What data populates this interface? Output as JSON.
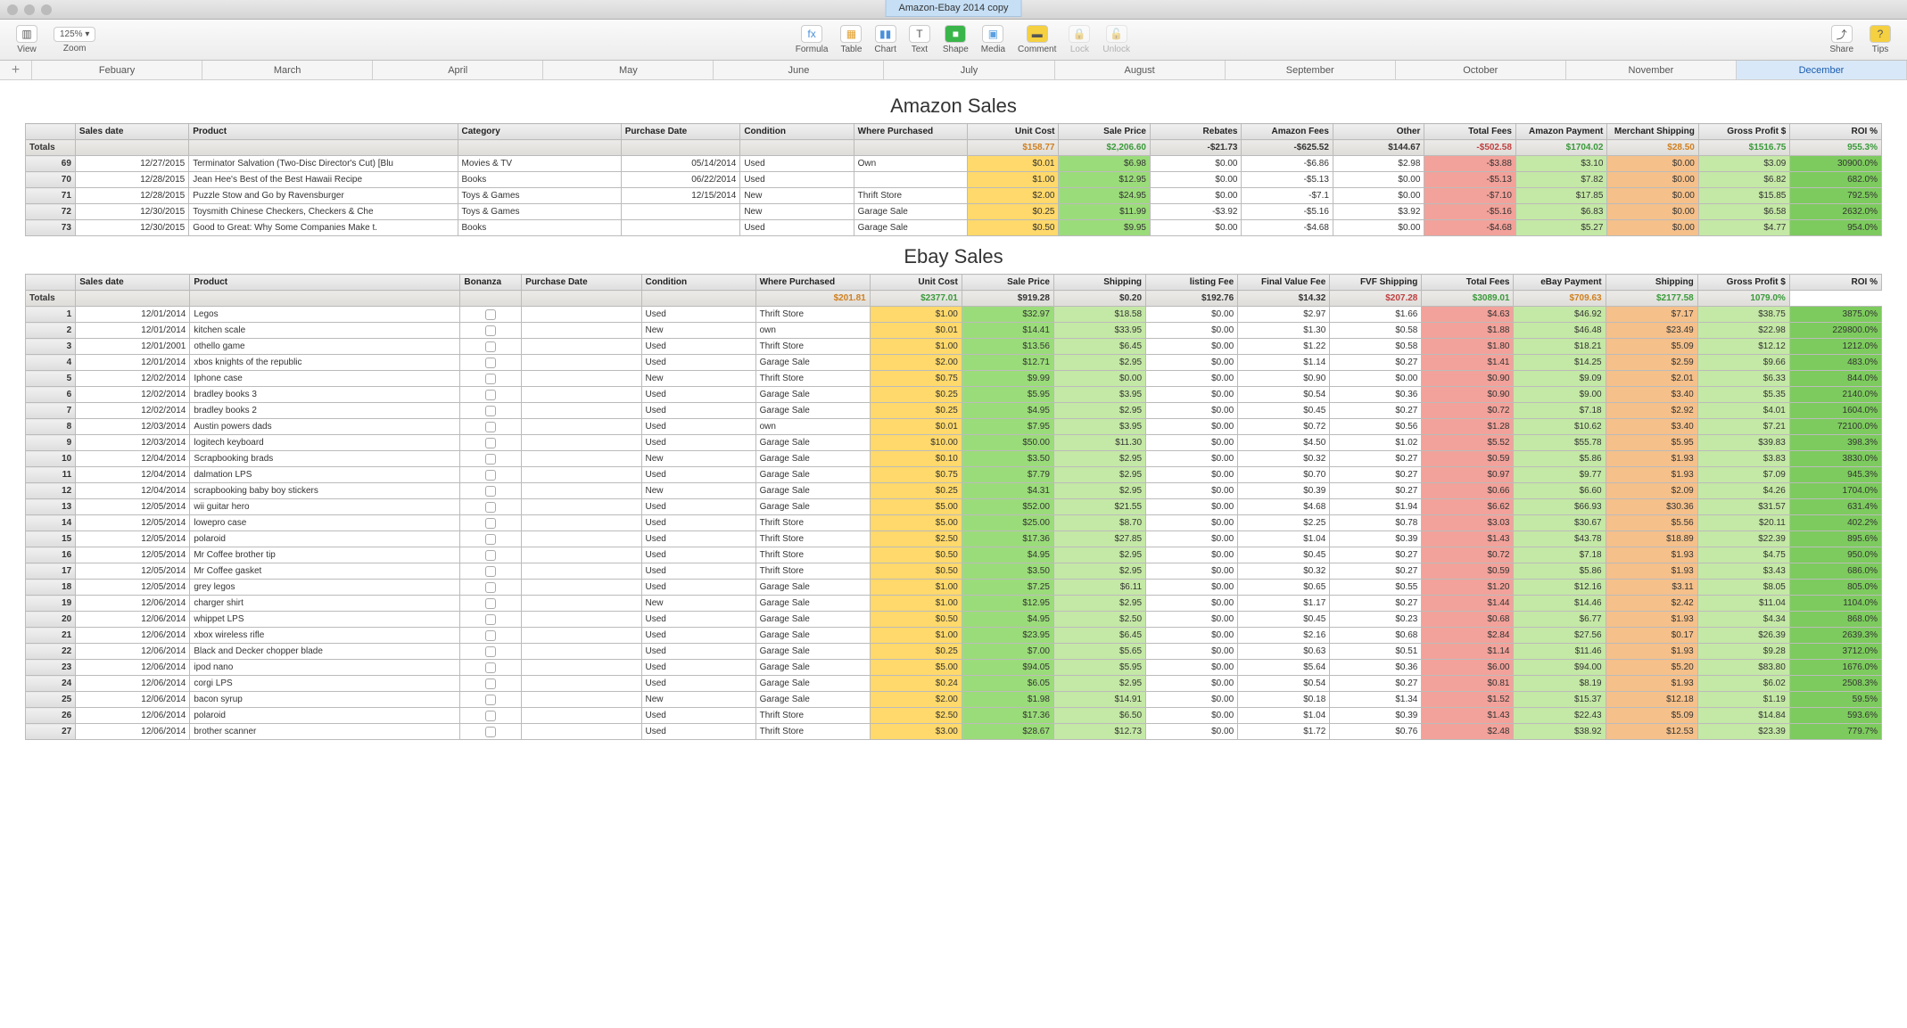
{
  "window": {
    "title": "Amazon-Ebay 2014 copy"
  },
  "toolbar": {
    "view": "View",
    "zoom": "Zoom",
    "zoom_val": "125%",
    "formula": "Formula",
    "table": "Table",
    "chart": "Chart",
    "text": "Text",
    "shape": "Shape",
    "media": "Media",
    "comment": "Comment",
    "lock": "Lock",
    "unlock": "Unlock",
    "share": "Share",
    "tips": "Tips"
  },
  "tabs": {
    "plus": "+",
    "items": [
      "Febuary",
      "March",
      "April",
      "May",
      "June",
      "July",
      "August",
      "September",
      "October",
      "November",
      "December"
    ],
    "active": "December"
  },
  "amazon": {
    "title": "Amazon Sales",
    "headers": [
      "Sales date",
      "Product",
      "Category",
      "Purchase Date",
      "Condition",
      "Where Purchased",
      "Unit Cost",
      "Sale Price",
      "Rebates",
      "Amazon Fees",
      "Other",
      "Total Fees",
      "Amazon Payment",
      "Merchant Shipping",
      "Gross Profit $",
      "ROI %"
    ],
    "totals_label": "Totals",
    "totals": {
      "unit": "$158.77",
      "sale": "$2,206.60",
      "rebates": "-$21.73",
      "fees": "-$625.52",
      "other": "$144.67",
      "tfees": "-$502.58",
      "pay": "$1704.02",
      "ship": "$28.50",
      "gp": "$1516.75",
      "roi": "955.3%"
    },
    "rows": [
      {
        "n": "69",
        "date": "12/27/2015",
        "prod": "Terminator Salvation (Two-Disc Director's Cut) [Blu",
        "cat": "Movies & TV",
        "pd": "05/14/2014",
        "cond": "Used",
        "wp": "Own",
        "unit": "$0.01",
        "sale": "$6.98",
        "reb": "$0.00",
        "af": "-$6.86",
        "oth": "$2.98",
        "tf": "-$3.88",
        "pay": "$3.10",
        "ms": "$0.00",
        "gp": "$3.09",
        "roi": "30900.0%"
      },
      {
        "n": "70",
        "date": "12/28/2015",
        "prod": "Jean Hee's Best of the Best Hawaii Recipe",
        "cat": "Books",
        "pd": "06/22/2014",
        "cond": "Used",
        "wp": "",
        "unit": "$1.00",
        "sale": "$12.95",
        "reb": "$0.00",
        "af": "-$5.13",
        "oth": "$0.00",
        "tf": "-$5.13",
        "pay": "$7.82",
        "ms": "$0.00",
        "gp": "$6.82",
        "roi": "682.0%"
      },
      {
        "n": "71",
        "date": "12/28/2015",
        "prod": "Puzzle Stow and Go by Ravensburger",
        "cat": "Toys & Games",
        "pd": "12/15/2014",
        "cond": "New",
        "wp": "Thrift Store",
        "unit": "$2.00",
        "sale": "$24.95",
        "reb": "$0.00",
        "af": "-$7.1",
        "oth": "$0.00",
        "tf": "-$7.10",
        "pay": "$17.85",
        "ms": "$0.00",
        "gp": "$15.85",
        "roi": "792.5%"
      },
      {
        "n": "72",
        "date": "12/30/2015",
        "prod": "Toysmith Chinese Checkers, Checkers &#38; Che",
        "cat": "Toys & Games",
        "pd": "",
        "cond": "New",
        "wp": "Garage Sale",
        "unit": "$0.25",
        "sale": "$11.99",
        "reb": "-$3.92",
        "af": "-$5.16",
        "oth": "$3.92",
        "tf": "-$5.16",
        "pay": "$6.83",
        "ms": "$0.00",
        "gp": "$6.58",
        "roi": "2632.0%"
      },
      {
        "n": "73",
        "date": "12/30/2015",
        "prod": "Good to Great: Why Some Companies Make t.",
        "cat": "Books",
        "pd": "",
        "cond": "Used",
        "wp": "Garage Sale",
        "unit": "$0.50",
        "sale": "$9.95",
        "reb": "$0.00",
        "af": "-$4.68",
        "oth": "$0.00",
        "tf": "-$4.68",
        "pay": "$5.27",
        "ms": "$0.00",
        "gp": "$4.77",
        "roi": "954.0%"
      }
    ]
  },
  "ebay": {
    "title": "Ebay Sales",
    "headers": [
      "Sales date",
      "Product",
      "Bonanza",
      "Purchase Date",
      "Condition",
      "Where Purchased",
      "Unit Cost",
      "Sale Price",
      "Shipping",
      "listing Fee",
      "Final Value Fee",
      "FVF Shipping",
      "Total Fees",
      "eBay Payment",
      "Shipping",
      "Gross Profit $",
      "ROI %"
    ],
    "totals_label": "Totals",
    "totals": {
      "unit": "$201.81",
      "sale": "$2377.01",
      "ship": "$919.28",
      "lf": "$0.20",
      "fvf": "$192.76",
      "fvs": "$14.32",
      "tf": "$207.28",
      "pay": "$3089.01",
      "ship2": "$709.63",
      "gp": "$2177.58",
      "roi": "1079.0%"
    },
    "rows": [
      {
        "n": "1",
        "date": "12/01/2014",
        "prod": "Legos",
        "cond": "Used",
        "wp": "Thrift Store",
        "unit": "$1.00",
        "sale": "$32.97",
        "ship": "$18.58",
        "lf": "$0.00",
        "fvf": "$2.97",
        "fvs": "$1.66",
        "tf": "$4.63",
        "pay": "$46.92",
        "ship2": "$7.17",
        "gp": "$38.75",
        "roi": "3875.0%"
      },
      {
        "n": "2",
        "date": "12/01/2014",
        "prod": "kitchen scale",
        "cond": "New",
        "wp": "own",
        "unit": "$0.01",
        "sale": "$14.41",
        "ship": "$33.95",
        "lf": "$0.00",
        "fvf": "$1.30",
        "fvs": "$0.58",
        "tf": "$1.88",
        "pay": "$46.48",
        "ship2": "$23.49",
        "gp": "$22.98",
        "roi": "229800.0%"
      },
      {
        "n": "3",
        "date": "12/01/2001",
        "prod": "othello game",
        "cond": "Used",
        "wp": "Thrift Store",
        "unit": "$1.00",
        "sale": "$13.56",
        "ship": "$6.45",
        "lf": "$0.00",
        "fvf": "$1.22",
        "fvs": "$0.58",
        "tf": "$1.80",
        "pay": "$18.21",
        "ship2": "$5.09",
        "gp": "$12.12",
        "roi": "1212.0%"
      },
      {
        "n": "4",
        "date": "12/01/2014",
        "prod": "xbos knights of the republic",
        "cond": "Used",
        "wp": "Garage Sale",
        "unit": "$2.00",
        "sale": "$12.71",
        "ship": "$2.95",
        "lf": "$0.00",
        "fvf": "$1.14",
        "fvs": "$0.27",
        "tf": "$1.41",
        "pay": "$14.25",
        "ship2": "$2.59",
        "gp": "$9.66",
        "roi": "483.0%"
      },
      {
        "n": "5",
        "date": "12/02/2014",
        "prod": "Iphone case",
        "cond": "New",
        "wp": "Thrift Store",
        "unit": "$0.75",
        "sale": "$9.99",
        "ship": "$0.00",
        "lf": "$0.00",
        "fvf": "$0.90",
        "fvs": "$0.00",
        "tf": "$0.90",
        "pay": "$9.09",
        "ship2": "$2.01",
        "gp": "$6.33",
        "roi": "844.0%"
      },
      {
        "n": "6",
        "date": "12/02/2014",
        "prod": "bradley books 3",
        "cond": "Used",
        "wp": "Garage Sale",
        "unit": "$0.25",
        "sale": "$5.95",
        "ship": "$3.95",
        "lf": "$0.00",
        "fvf": "$0.54",
        "fvs": "$0.36",
        "tf": "$0.90",
        "pay": "$9.00",
        "ship2": "$3.40",
        "gp": "$5.35",
        "roi": "2140.0%"
      },
      {
        "n": "7",
        "date": "12/02/2014",
        "prod": "bradley books 2",
        "cond": "Used",
        "wp": "Garage Sale",
        "unit": "$0.25",
        "sale": "$4.95",
        "ship": "$2.95",
        "lf": "$0.00",
        "fvf": "$0.45",
        "fvs": "$0.27",
        "tf": "$0.72",
        "pay": "$7.18",
        "ship2": "$2.92",
        "gp": "$4.01",
        "roi": "1604.0%"
      },
      {
        "n": "8",
        "date": "12/03/2014",
        "prod": "Austin powers dads",
        "cond": "Used",
        "wp": "own",
        "unit": "$0.01",
        "sale": "$7.95",
        "ship": "$3.95",
        "lf": "$0.00",
        "fvf": "$0.72",
        "fvs": "$0.56",
        "tf": "$1.28",
        "pay": "$10.62",
        "ship2": "$3.40",
        "gp": "$7.21",
        "roi": "72100.0%"
      },
      {
        "n": "9",
        "date": "12/03/2014",
        "prod": "logitech keyboard",
        "cond": "Used",
        "wp": "Garage Sale",
        "unit": "$10.00",
        "sale": "$50.00",
        "ship": "$11.30",
        "lf": "$0.00",
        "fvf": "$4.50",
        "fvs": "$1.02",
        "tf": "$5.52",
        "pay": "$55.78",
        "ship2": "$5.95",
        "gp": "$39.83",
        "roi": "398.3%"
      },
      {
        "n": "10",
        "date": "12/04/2014",
        "prod": "Scrapbooking brads",
        "cond": "New",
        "wp": "Garage Sale",
        "unit": "$0.10",
        "sale": "$3.50",
        "ship": "$2.95",
        "lf": "$0.00",
        "fvf": "$0.32",
        "fvs": "$0.27",
        "tf": "$0.59",
        "pay": "$5.86",
        "ship2": "$1.93",
        "gp": "$3.83",
        "roi": "3830.0%"
      },
      {
        "n": "11",
        "date": "12/04/2014",
        "prod": "dalmation LPS",
        "cond": "Used",
        "wp": "Garage Sale",
        "unit": "$0.75",
        "sale": "$7.79",
        "ship": "$2.95",
        "lf": "$0.00",
        "fvf": "$0.70",
        "fvs": "$0.27",
        "tf": "$0.97",
        "pay": "$9.77",
        "ship2": "$1.93",
        "gp": "$7.09",
        "roi": "945.3%"
      },
      {
        "n": "12",
        "date": "12/04/2014",
        "prod": "scrapbooking baby boy stickers",
        "cond": "New",
        "wp": "Garage Sale",
        "unit": "$0.25",
        "sale": "$4.31",
        "ship": "$2.95",
        "lf": "$0.00",
        "fvf": "$0.39",
        "fvs": "$0.27",
        "tf": "$0.66",
        "pay": "$6.60",
        "ship2": "$2.09",
        "gp": "$4.26",
        "roi": "1704.0%"
      },
      {
        "n": "13",
        "date": "12/05/2014",
        "prod": "wii guitar hero",
        "cond": "Used",
        "wp": "Garage Sale",
        "unit": "$5.00",
        "sale": "$52.00",
        "ship": "$21.55",
        "lf": "$0.00",
        "fvf": "$4.68",
        "fvs": "$1.94",
        "tf": "$6.62",
        "pay": "$66.93",
        "ship2": "$30.36",
        "gp": "$31.57",
        "roi": "631.4%"
      },
      {
        "n": "14",
        "date": "12/05/2014",
        "prod": "lowepro case",
        "cond": "Used",
        "wp": "Thrift Store",
        "unit": "$5.00",
        "sale": "$25.00",
        "ship": "$8.70",
        "lf": "$0.00",
        "fvf": "$2.25",
        "fvs": "$0.78",
        "tf": "$3.03",
        "pay": "$30.67",
        "ship2": "$5.56",
        "gp": "$20.11",
        "roi": "402.2%"
      },
      {
        "n": "15",
        "date": "12/05/2014",
        "prod": "polaroid",
        "cond": "Used",
        "wp": "Thrift Store",
        "unit": "$2.50",
        "sale": "$17.36",
        "ship": "$27.85",
        "lf": "$0.00",
        "fvf": "$1.04",
        "fvs": "$0.39",
        "tf": "$1.43",
        "pay": "$43.78",
        "ship2": "$18.89",
        "gp": "$22.39",
        "roi": "895.6%"
      },
      {
        "n": "16",
        "date": "12/05/2014",
        "prod": "Mr Coffee brother tip",
        "cond": "Used",
        "wp": "Thrift Store",
        "unit": "$0.50",
        "sale": "$4.95",
        "ship": "$2.95",
        "lf": "$0.00",
        "fvf": "$0.45",
        "fvs": "$0.27",
        "tf": "$0.72",
        "pay": "$7.18",
        "ship2": "$1.93",
        "gp": "$4.75",
        "roi": "950.0%"
      },
      {
        "n": "17",
        "date": "12/05/2014",
        "prod": "Mr Coffee gasket",
        "cond": "Used",
        "wp": "Thrift Store",
        "unit": "$0.50",
        "sale": "$3.50",
        "ship": "$2.95",
        "lf": "$0.00",
        "fvf": "$0.32",
        "fvs": "$0.27",
        "tf": "$0.59",
        "pay": "$5.86",
        "ship2": "$1.93",
        "gp": "$3.43",
        "roi": "686.0%"
      },
      {
        "n": "18",
        "date": "12/05/2014",
        "prod": "grey legos",
        "cond": "Used",
        "wp": "Garage Sale",
        "unit": "$1.00",
        "sale": "$7.25",
        "ship": "$6.11",
        "lf": "$0.00",
        "fvf": "$0.65",
        "fvs": "$0.55",
        "tf": "$1.20",
        "pay": "$12.16",
        "ship2": "$3.11",
        "gp": "$8.05",
        "roi": "805.0%"
      },
      {
        "n": "19",
        "date": "12/06/2014",
        "prod": "charger shirt",
        "cond": "New",
        "wp": "Garage Sale",
        "unit": "$1.00",
        "sale": "$12.95",
        "ship": "$2.95",
        "lf": "$0.00",
        "fvf": "$1.17",
        "fvs": "$0.27",
        "tf": "$1.44",
        "pay": "$14.46",
        "ship2": "$2.42",
        "gp": "$11.04",
        "roi": "1104.0%"
      },
      {
        "n": "20",
        "date": "12/06/2014",
        "prod": "whippet LPS",
        "cond": "Used",
        "wp": "Garage Sale",
        "unit": "$0.50",
        "sale": "$4.95",
        "ship": "$2.50",
        "lf": "$0.00",
        "fvf": "$0.45",
        "fvs": "$0.23",
        "tf": "$0.68",
        "pay": "$6.77",
        "ship2": "$1.93",
        "gp": "$4.34",
        "roi": "868.0%"
      },
      {
        "n": "21",
        "date": "12/06/2014",
        "prod": "xbox wireless rifle",
        "cond": "Used",
        "wp": "Garage Sale",
        "unit": "$1.00",
        "sale": "$23.95",
        "ship": "$6.45",
        "lf": "$0.00",
        "fvf": "$2.16",
        "fvs": "$0.68",
        "tf": "$2.84",
        "pay": "$27.56",
        "ship2": "$0.17",
        "gp": "$26.39",
        "roi": "2639.3%"
      },
      {
        "n": "22",
        "date": "12/06/2014",
        "prod": "Black and Decker chopper blade",
        "cond": "Used",
        "wp": "Garage Sale",
        "unit": "$0.25",
        "sale": "$7.00",
        "ship": "$5.65",
        "lf": "$0.00",
        "fvf": "$0.63",
        "fvs": "$0.51",
        "tf": "$1.14",
        "pay": "$11.46",
        "ship2": "$1.93",
        "gp": "$9.28",
        "roi": "3712.0%"
      },
      {
        "n": "23",
        "date": "12/06/2014",
        "prod": "ipod nano",
        "cond": "Used",
        "wp": "Garage Sale",
        "unit": "$5.00",
        "sale": "$94.05",
        "ship": "$5.95",
        "lf": "$0.00",
        "fvf": "$5.64",
        "fvs": "$0.36",
        "tf": "$6.00",
        "pay": "$94.00",
        "ship2": "$5.20",
        "gp": "$83.80",
        "roi": "1676.0%"
      },
      {
        "n": "24",
        "date": "12/06/2014",
        "prod": "corgi LPS",
        "cond": "Used",
        "wp": "Garage Sale",
        "unit": "$0.24",
        "sale": "$6.05",
        "ship": "$2.95",
        "lf": "$0.00",
        "fvf": "$0.54",
        "fvs": "$0.27",
        "tf": "$0.81",
        "pay": "$8.19",
        "ship2": "$1.93",
        "gp": "$6.02",
        "roi": "2508.3%"
      },
      {
        "n": "25",
        "date": "12/06/2014",
        "prod": "bacon syrup",
        "cond": "New",
        "wp": "Garage Sale",
        "unit": "$2.00",
        "sale": "$1.98",
        "ship": "$14.91",
        "lf": "$0.00",
        "fvf": "$0.18",
        "fvs": "$1.34",
        "tf": "$1.52",
        "pay": "$15.37",
        "ship2": "$12.18",
        "gp": "$1.19",
        "roi": "59.5%"
      },
      {
        "n": "26",
        "date": "12/06/2014",
        "prod": "polaroid",
        "cond": "Used",
        "wp": "Thrift Store",
        "unit": "$2.50",
        "sale": "$17.36",
        "ship": "$6.50",
        "lf": "$0.00",
        "fvf": "$1.04",
        "fvs": "$0.39",
        "tf": "$1.43",
        "pay": "$22.43",
        "ship2": "$5.09",
        "gp": "$14.84",
        "roi": "593.6%"
      },
      {
        "n": "27",
        "date": "12/06/2014",
        "prod": "brother scanner",
        "cond": "Used",
        "wp": "Thrift Store",
        "unit": "$3.00",
        "sale": "$28.67",
        "ship": "$12.73",
        "lf": "$0.00",
        "fvf": "$1.72",
        "fvs": "$0.76",
        "tf": "$2.48",
        "pay": "$38.92",
        "ship2": "$12.53",
        "gp": "$23.39",
        "roi": "779.7%"
      }
    ]
  }
}
